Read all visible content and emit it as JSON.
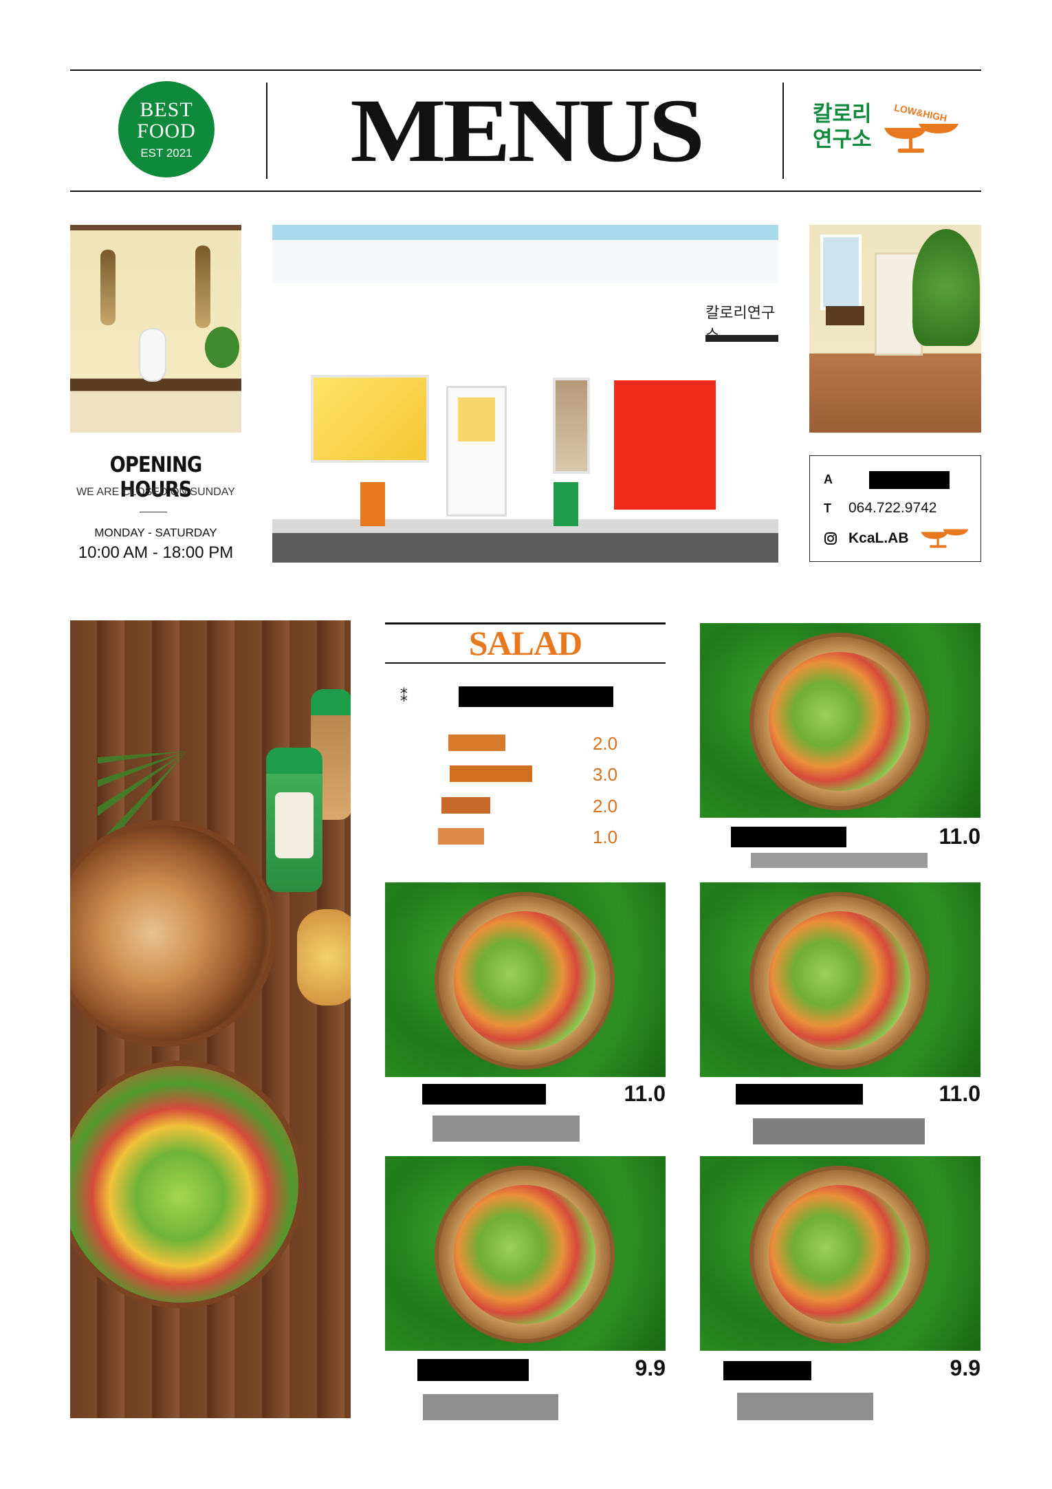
{
  "header": {
    "badge": {
      "line1": "BEST",
      "line2": "FOOD",
      "line3": "EST 2021"
    },
    "title": "MENUS",
    "brand": {
      "line1": "칼로리",
      "line2": "연구소",
      "tag": "LOW&HIGH"
    }
  },
  "storefront_sign": "칼로리연구소",
  "hours": {
    "title": "OPENING HOURS",
    "note": "WE ARE CLOSED ON SUNDAY",
    "days": "MONDAY - SATURDAY",
    "time": "10:00 AM - 18:00 PM"
  },
  "contact": {
    "address_key": "A",
    "phone_key": "T",
    "phone": "064.722.9742",
    "instagram": "KcaL.AB"
  },
  "salad": {
    "title": "SALAD",
    "macros": [
      {
        "value": "2.0",
        "bar_fill": 0.36
      },
      {
        "value": "3.0",
        "bar_fill": 0.52
      },
      {
        "value": "2.0",
        "bar_fill": 0.31
      },
      {
        "value": "1.0",
        "bar_fill": 0.29
      }
    ],
    "items": [
      {
        "price": "11.0"
      },
      {
        "price": "11.0"
      },
      {
        "price": "11.0"
      },
      {
        "price": "9.9"
      },
      {
        "price": "9.9"
      }
    ]
  },
  "colors": {
    "brand_green": "#0f8a3c",
    "brand_orange": "#e8781e",
    "macro_text": "#d9701d",
    "salad_title": "#e8781e",
    "storefront_red": "#ef2a1a",
    "redaction": "#000000",
    "grey_block": "#8f8f8f"
  },
  "icons": {
    "instagram": "instagram-icon",
    "scale": "scale-logo-icon",
    "spark": "sparkle-icon"
  }
}
